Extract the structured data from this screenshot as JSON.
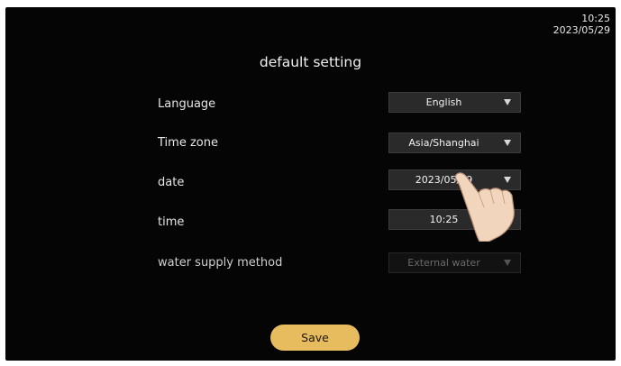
{
  "status_bar": {
    "time": "10:25",
    "date": "2023/05/29"
  },
  "page": {
    "title": "default setting"
  },
  "settings": [
    {
      "label": "Language",
      "value": "English",
      "enabled": true
    },
    {
      "label": "Time zone",
      "value": "Asia/Shanghai",
      "enabled": true
    },
    {
      "label": "date",
      "value": "2023/05/29",
      "enabled": true
    },
    {
      "label": "time",
      "value": "10:25",
      "enabled": true
    },
    {
      "label": "water supply method",
      "value": "External water",
      "enabled": false
    }
  ],
  "actions": {
    "save_label": "Save"
  },
  "colors": {
    "background": "#050505",
    "dropdown": "#2a2a2a",
    "accent": "#e6bc5f"
  },
  "icons": {
    "dropdown": "chevron-down-icon",
    "pointer": "pointing-hand-icon"
  }
}
